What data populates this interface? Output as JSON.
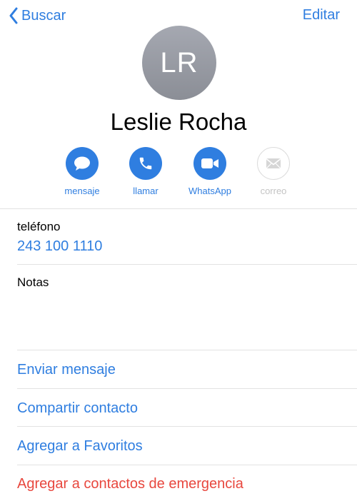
{
  "nav": {
    "back_label": "Buscar",
    "edit_label": "Editar"
  },
  "contact": {
    "initials": "LR",
    "name": "Leslie Rocha"
  },
  "actions": [
    {
      "label": "mensaje",
      "icon": "message-bubble-icon",
      "enabled": true
    },
    {
      "label": "llamar",
      "icon": "phone-icon",
      "enabled": true
    },
    {
      "label": "WhatsApp",
      "icon": "video-icon",
      "enabled": true
    },
    {
      "label": "correo",
      "icon": "mail-icon",
      "enabled": false
    }
  ],
  "phone": {
    "label": "teléfono",
    "value": "243 100 1110"
  },
  "notes": {
    "label": "Notas"
  },
  "rows": [
    {
      "label": "Enviar mensaje"
    },
    {
      "label": "Compartir contacto"
    },
    {
      "label": "Agregar a Favoritos"
    },
    {
      "label": "Agregar a contactos de emergencia"
    }
  ],
  "colors": {
    "accent": "#2f7ee0",
    "danger": "#e8473e",
    "avatar": "#9a9da5"
  }
}
